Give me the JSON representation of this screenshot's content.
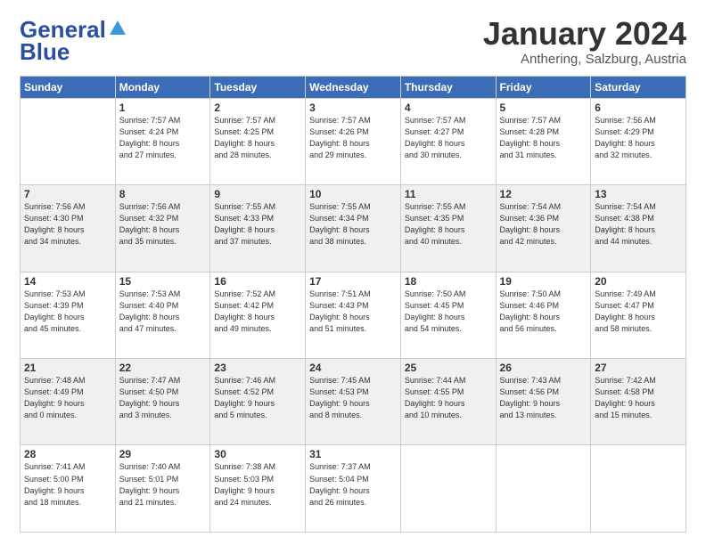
{
  "header": {
    "logo_line1": "General",
    "logo_line2": "Blue",
    "month_title": "January 2024",
    "subtitle": "Anthering, Salzburg, Austria"
  },
  "weekdays": [
    "Sunday",
    "Monday",
    "Tuesday",
    "Wednesday",
    "Thursday",
    "Friday",
    "Saturday"
  ],
  "weeks": [
    [
      {
        "day": "",
        "info": ""
      },
      {
        "day": "1",
        "info": "Sunrise: 7:57 AM\nSunset: 4:24 PM\nDaylight: 8 hours\nand 27 minutes."
      },
      {
        "day": "2",
        "info": "Sunrise: 7:57 AM\nSunset: 4:25 PM\nDaylight: 8 hours\nand 28 minutes."
      },
      {
        "day": "3",
        "info": "Sunrise: 7:57 AM\nSunset: 4:26 PM\nDaylight: 8 hours\nand 29 minutes."
      },
      {
        "day": "4",
        "info": "Sunrise: 7:57 AM\nSunset: 4:27 PM\nDaylight: 8 hours\nand 30 minutes."
      },
      {
        "day": "5",
        "info": "Sunrise: 7:57 AM\nSunset: 4:28 PM\nDaylight: 8 hours\nand 31 minutes."
      },
      {
        "day": "6",
        "info": "Sunrise: 7:56 AM\nSunset: 4:29 PM\nDaylight: 8 hours\nand 32 minutes."
      }
    ],
    [
      {
        "day": "7",
        "info": "Sunrise: 7:56 AM\nSunset: 4:30 PM\nDaylight: 8 hours\nand 34 minutes."
      },
      {
        "day": "8",
        "info": "Sunrise: 7:56 AM\nSunset: 4:32 PM\nDaylight: 8 hours\nand 35 minutes."
      },
      {
        "day": "9",
        "info": "Sunrise: 7:55 AM\nSunset: 4:33 PM\nDaylight: 8 hours\nand 37 minutes."
      },
      {
        "day": "10",
        "info": "Sunrise: 7:55 AM\nSunset: 4:34 PM\nDaylight: 8 hours\nand 38 minutes."
      },
      {
        "day": "11",
        "info": "Sunrise: 7:55 AM\nSunset: 4:35 PM\nDaylight: 8 hours\nand 40 minutes."
      },
      {
        "day": "12",
        "info": "Sunrise: 7:54 AM\nSunset: 4:36 PM\nDaylight: 8 hours\nand 42 minutes."
      },
      {
        "day": "13",
        "info": "Sunrise: 7:54 AM\nSunset: 4:38 PM\nDaylight: 8 hours\nand 44 minutes."
      }
    ],
    [
      {
        "day": "14",
        "info": "Sunrise: 7:53 AM\nSunset: 4:39 PM\nDaylight: 8 hours\nand 45 minutes."
      },
      {
        "day": "15",
        "info": "Sunrise: 7:53 AM\nSunset: 4:40 PM\nDaylight: 8 hours\nand 47 minutes."
      },
      {
        "day": "16",
        "info": "Sunrise: 7:52 AM\nSunset: 4:42 PM\nDaylight: 8 hours\nand 49 minutes."
      },
      {
        "day": "17",
        "info": "Sunrise: 7:51 AM\nSunset: 4:43 PM\nDaylight: 8 hours\nand 51 minutes."
      },
      {
        "day": "18",
        "info": "Sunrise: 7:50 AM\nSunset: 4:45 PM\nDaylight: 8 hours\nand 54 minutes."
      },
      {
        "day": "19",
        "info": "Sunrise: 7:50 AM\nSunset: 4:46 PM\nDaylight: 8 hours\nand 56 minutes."
      },
      {
        "day": "20",
        "info": "Sunrise: 7:49 AM\nSunset: 4:47 PM\nDaylight: 8 hours\nand 58 minutes."
      }
    ],
    [
      {
        "day": "21",
        "info": "Sunrise: 7:48 AM\nSunset: 4:49 PM\nDaylight: 9 hours\nand 0 minutes."
      },
      {
        "day": "22",
        "info": "Sunrise: 7:47 AM\nSunset: 4:50 PM\nDaylight: 9 hours\nand 3 minutes."
      },
      {
        "day": "23",
        "info": "Sunrise: 7:46 AM\nSunset: 4:52 PM\nDaylight: 9 hours\nand 5 minutes."
      },
      {
        "day": "24",
        "info": "Sunrise: 7:45 AM\nSunset: 4:53 PM\nDaylight: 9 hours\nand 8 minutes."
      },
      {
        "day": "25",
        "info": "Sunrise: 7:44 AM\nSunset: 4:55 PM\nDaylight: 9 hours\nand 10 minutes."
      },
      {
        "day": "26",
        "info": "Sunrise: 7:43 AM\nSunset: 4:56 PM\nDaylight: 9 hours\nand 13 minutes."
      },
      {
        "day": "27",
        "info": "Sunrise: 7:42 AM\nSunset: 4:58 PM\nDaylight: 9 hours\nand 15 minutes."
      }
    ],
    [
      {
        "day": "28",
        "info": "Sunrise: 7:41 AM\nSunset: 5:00 PM\nDaylight: 9 hours\nand 18 minutes."
      },
      {
        "day": "29",
        "info": "Sunrise: 7:40 AM\nSunset: 5:01 PM\nDaylight: 9 hours\nand 21 minutes."
      },
      {
        "day": "30",
        "info": "Sunrise: 7:38 AM\nSunset: 5:03 PM\nDaylight: 9 hours\nand 24 minutes."
      },
      {
        "day": "31",
        "info": "Sunrise: 7:37 AM\nSunset: 5:04 PM\nDaylight: 9 hours\nand 26 minutes."
      },
      {
        "day": "",
        "info": ""
      },
      {
        "day": "",
        "info": ""
      },
      {
        "day": "",
        "info": ""
      }
    ]
  ]
}
